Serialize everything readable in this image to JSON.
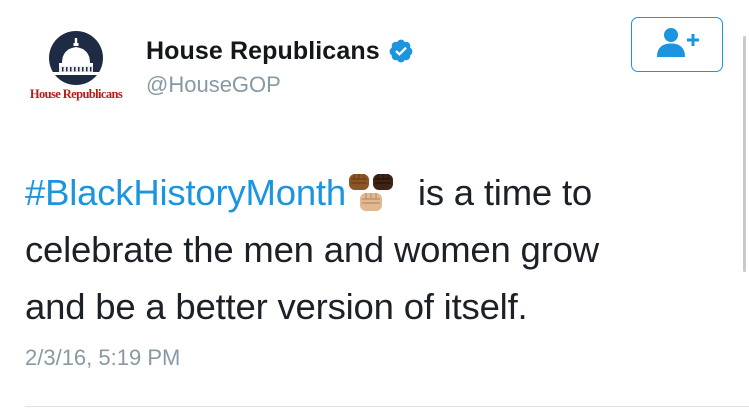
{
  "tweet": {
    "avatar": {
      "caption": "House Republicans",
      "icon": "capitol-dome-icon"
    },
    "author": {
      "display_name": "House Republicans",
      "handle": "@HouseGOP",
      "verified": true,
      "verified_icon": "verified-badge-icon"
    },
    "follow_button": {
      "icon": "add-user-icon"
    },
    "text": {
      "hashtag": "#BlackHistoryMonth",
      "emoji": "raised-fists-emoji",
      "line1_rest": " is a time to",
      "line2": "celebrate the men and women grow",
      "line3": "and be a better version of itself."
    },
    "timestamp": "2/3/16, 5:19 PM"
  },
  "colors": {
    "link_blue": "#1b95e0",
    "secondary_text": "#8899a6",
    "primary_text": "#1c2127",
    "brand_red": "#b71c1c",
    "avatar_navy": "#1f2a44"
  }
}
